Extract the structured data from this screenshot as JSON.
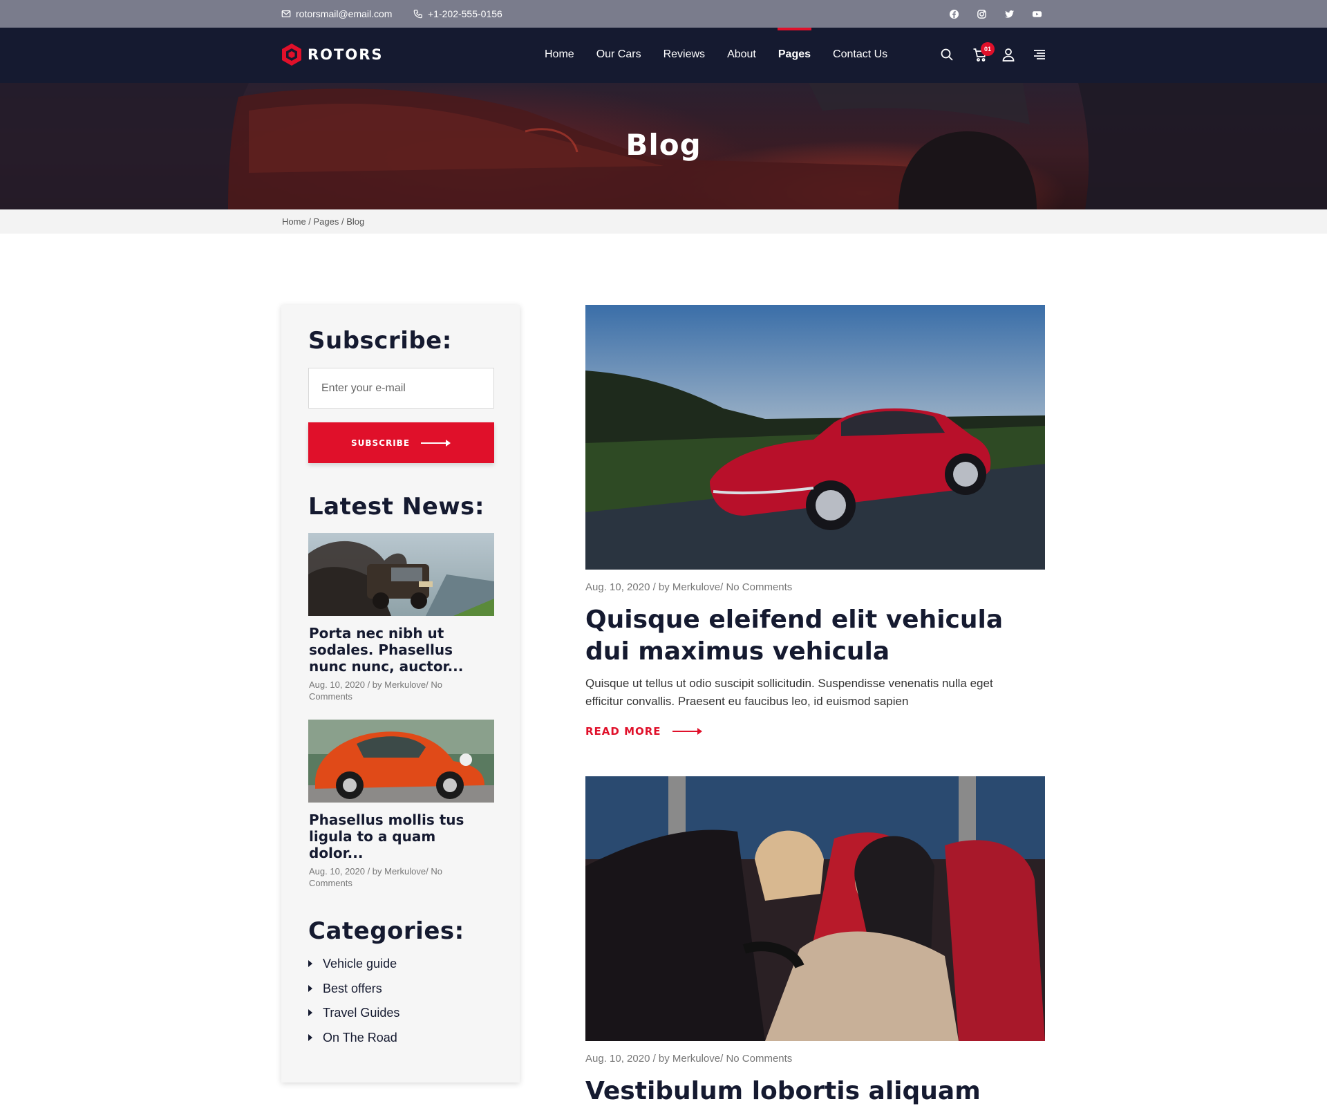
{
  "topbar": {
    "email": "rotorsmail@email.com",
    "phone": "+1-202-555-0156",
    "social": [
      "facebook-icon",
      "instagram-icon",
      "twitter-icon",
      "youtube-icon"
    ]
  },
  "nav": {
    "logo_text": "ROTORS",
    "links": [
      {
        "label": "Home",
        "active": false
      },
      {
        "label": "Our Cars",
        "active": false
      },
      {
        "label": "Reviews",
        "active": false
      },
      {
        "label": "About",
        "active": false
      },
      {
        "label": "Pages",
        "active": true
      },
      {
        "label": "Contact Us",
        "active": false
      }
    ],
    "cart_count": "01",
    "icons": [
      "search-icon",
      "cart-icon",
      "user-icon",
      "menu-icon"
    ]
  },
  "hero": {
    "title": "Blog"
  },
  "breadcrumb": "Home / Pages / Blog",
  "sidebar": {
    "subscribe": {
      "heading": "Subscribe:",
      "placeholder": "Enter your e-mail",
      "button_label": "SUBSCRIBE"
    },
    "latest_news": {
      "heading": "Latest News:",
      "items": [
        {
          "title": "Porta nec nibh ut sodales. Phasellus nunc nunc, auctor...",
          "meta": "Aug. 10, 2020 / by Merkulove/ No Comments"
        },
        {
          "title": "Phasellus mollis tus ligula to a quam dolor...",
          "meta": "Aug. 10, 2020 / by Merkulove/ No Comments"
        }
      ]
    },
    "categories": {
      "heading": "Categories:",
      "items": [
        "Vehicle guide",
        "Best offers",
        "Travel Guides",
        "On The Road"
      ]
    }
  },
  "posts": [
    {
      "meta": "Aug. 10, 2020 / by Merkulove/ No Comments",
      "title": "Quisque eleifend elit vehicula dui maximus vehicula",
      "excerpt": "Quisque ut tellus ut odio suscipit sollicitudin. Suspendisse venenatis nulla eget efficitur convallis. Praesent eu faucibus leo, id euismod sapien",
      "read_more": "READ MORE"
    },
    {
      "meta": "Aug. 10, 2020 / by Merkulove/ No Comments",
      "title": "Vestibulum lobortis aliquam nisl"
    }
  ],
  "colors": {
    "accent": "#e0102a",
    "nav_bg": "#151a30",
    "topbar_bg": "#7a7c8c"
  }
}
